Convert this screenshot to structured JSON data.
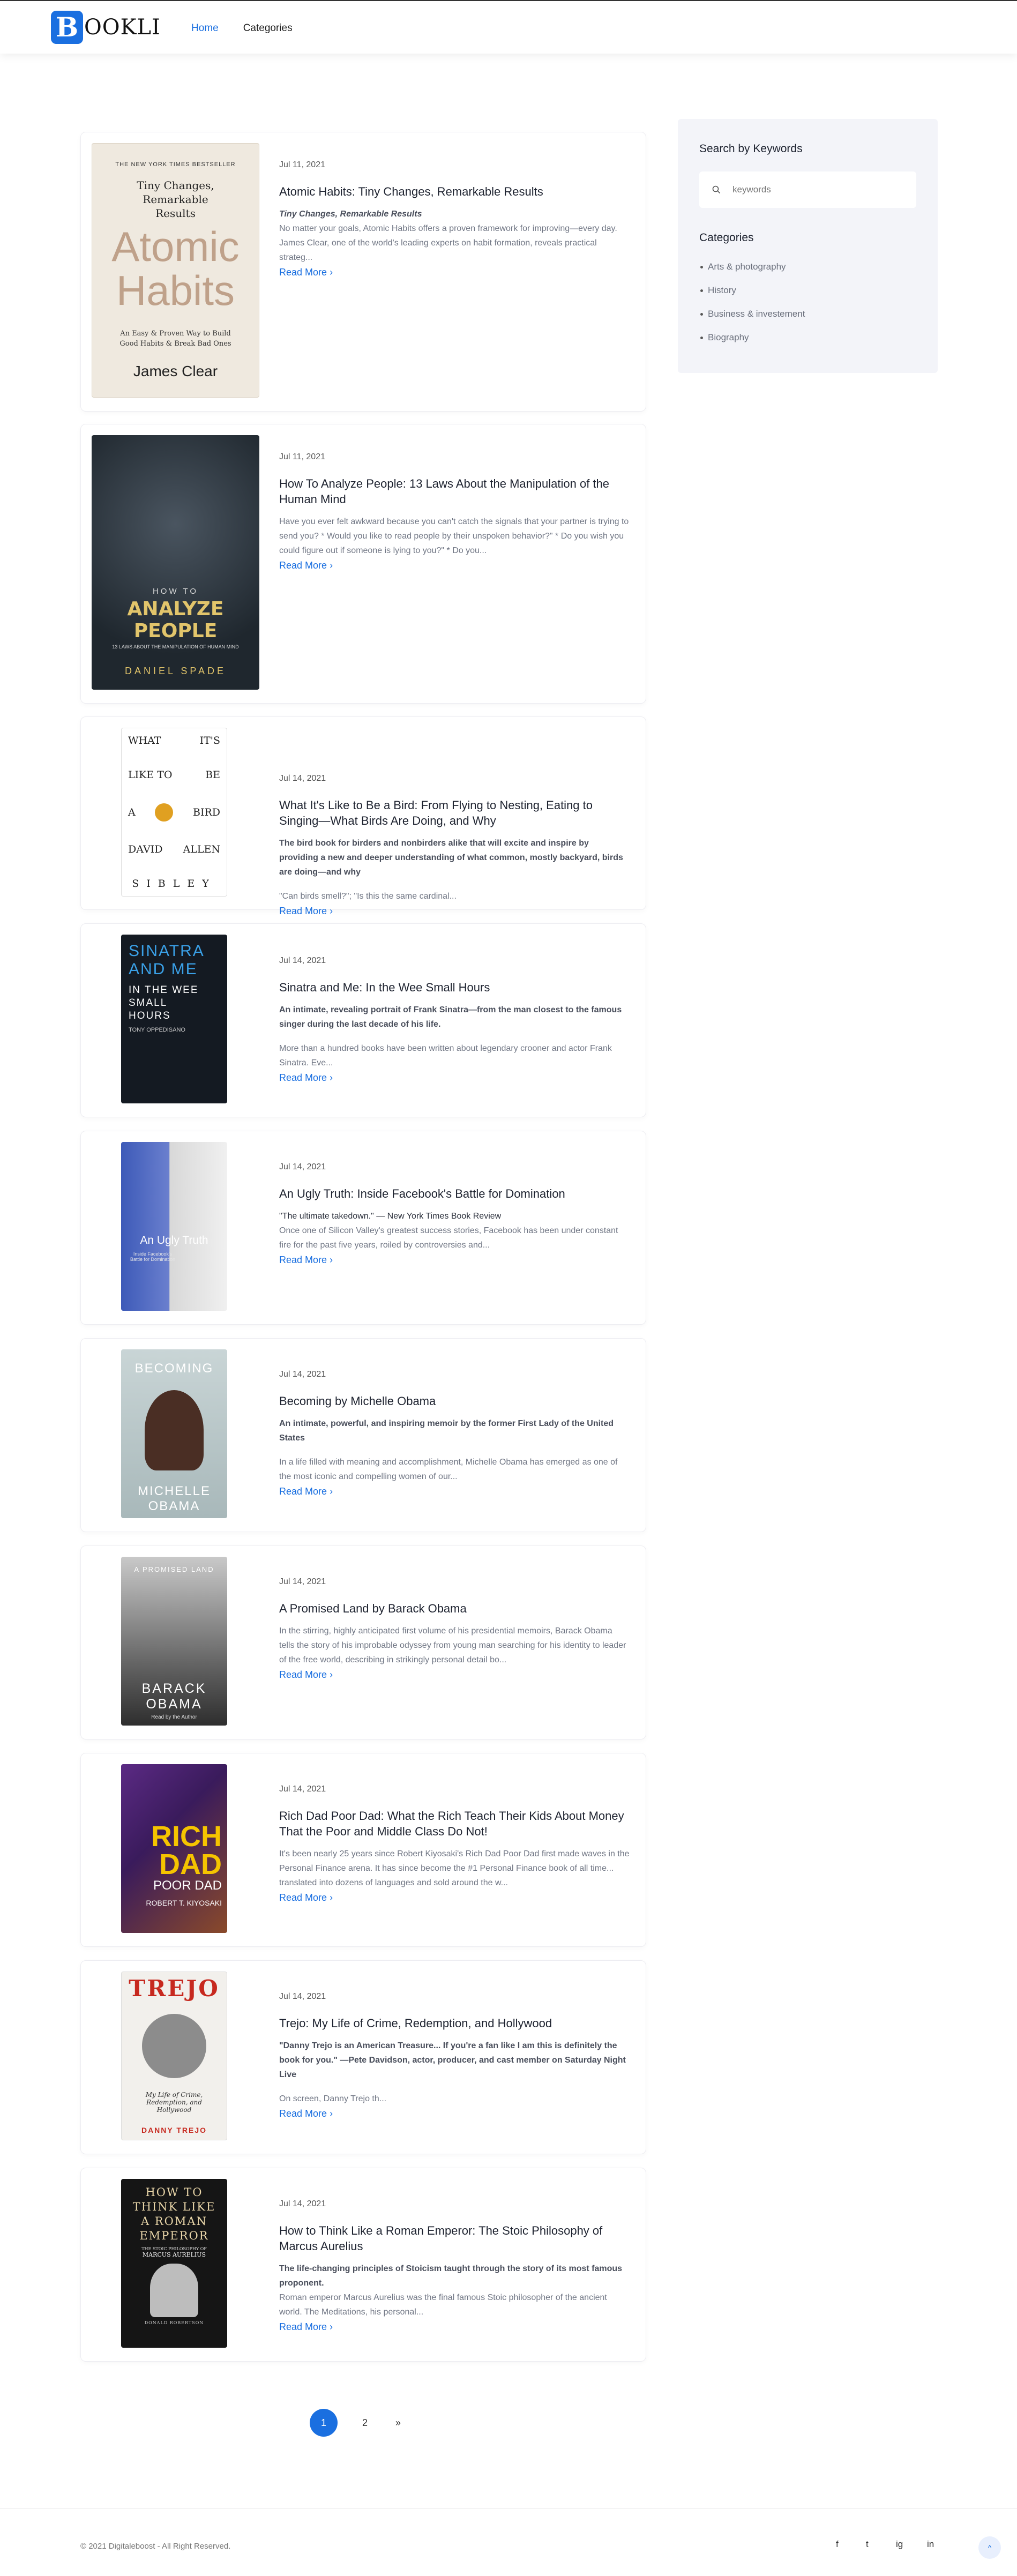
{
  "brand": {
    "logo_letter": "B",
    "logo_rest": "OOKLI",
    "accent": "#1a6fe0"
  },
  "nav": {
    "home": "Home",
    "categories": "Categories"
  },
  "read_more": "Read More",
  "posts": [
    {
      "date": "Jul 11, 2021",
      "title": "Atomic Habits: Tiny Changes, Remarkable Results",
      "subtitle": "Tiny Changes, Remarkable Results",
      "description": "No matter your goals, Atomic Habits offers a proven framework for improving—every day. James Clear, one of the world's leading experts on habit formation, reveals practical strateg...",
      "cover": {
        "top": "THE NEW YORK TIMES BESTSELLER",
        "head": "Tiny Changes, Remarkable Results",
        "big1": "Atomic",
        "big2": "Habits",
        "small": "An Easy & Proven Way to Build Good Habits & Break Bad Ones",
        "author": "James Clear"
      }
    },
    {
      "date": "Jul 11, 2021",
      "title": "How To Analyze People: 13 Laws About the Manipulation of the Human Mind",
      "description": "Have you ever felt awkward because you can't catch the signals that your partner is trying to send you? * Would you like to read people by their unspoken behavior?\" * Do you wish you could figure out if someone is lying to you?\" * Do you...",
      "cover": {
        "small": "HOW TO",
        "big": "ANALYZE PEOPLE",
        "tag": "13 LAWS ABOUT THE MANIPULATION OF HUMAN MIND",
        "author": "DANIEL SPADE"
      }
    },
    {
      "date": "Jul 14, 2021",
      "title": "What It's Like to Be a Bird: From Flying to Nesting, Eating to Singing—What Birds Are Doing, and Why",
      "subtitle": "The bird book for birders and nonbirders alike that will excite and inspire by providing a new and deeper understanding of what common, mostly backyard, birds are doing—and why",
      "description": "\"Can birds smell?\"; \"Is this the same cardinal...",
      "cover": {
        "l1a": "WHAT",
        "l1b": "IT'S",
        "l2a": "LIKE TO",
        "l2b": "BE",
        "l3a": "A",
        "l3b": "BIRD",
        "l4a": "DAVID",
        "l4b": "ALLEN",
        "l5": "SIBLEY"
      }
    },
    {
      "date": "Jul 14, 2021",
      "title": "Sinatra and Me: In the Wee Small Hours",
      "subtitle": "An intimate, revealing portrait of Frank Sinatra—from the man closest to the famous singer during the last decade of his life.",
      "description": "More than a hundred books have been written about legendary crooner and actor Frank Sinatra. Eve...",
      "cover": {
        "big1": "SINATRA",
        "big2": "AND ME",
        "l3": "IN THE WEE",
        "l4": "SMALL",
        "l5": "HOURS",
        "author": "TONY OPPEDISANO"
      }
    },
    {
      "date": "Jul 14, 2021",
      "title": "An Ugly Truth: Inside Facebook's Battle for Domination",
      "subtitle": "\"The ultimate takedown.\" — New York Times Book Review",
      "description": "Once one of Silicon Valley's greatest success stories, Facebook has been under constant fire for the past five years, roiled by controversies and...",
      "cover": {
        "big": "An Ugly Truth",
        "small": "Inside Facebook's Battle for Domination"
      }
    },
    {
      "date": "Jul 14, 2021",
      "title": "Becoming by Michelle Obama",
      "subtitle": "An intimate, powerful, and inspiring memoir by the former First Lady of the United States",
      "description": "In a life filled with meaning and accomplishment, Michelle Obama has emerged as one of the most iconic and compelling women of our...",
      "cover": {
        "top": "BECOMING",
        "n1": "MICHELLE",
        "n2": "OBAMA"
      }
    },
    {
      "date": "Jul 14, 2021",
      "title": "A Promised Land by Barack Obama",
      "description": "In the stirring, highly anticipated first volume of his presidential memoirs, Barack Obama tells the story of his improbable odyssey from young man searching for his identity to leader of the free world, describing in strikingly personal detail bo...",
      "cover": {
        "top": "A PROMISED LAND",
        "n1": "BARACK",
        "n2": "OBAMA",
        "note": "Read by the Author"
      }
    },
    {
      "date": "Jul 14, 2021",
      "title": "Rich Dad Poor Dad: What the Rich Teach Their Kids About Money That the Poor and Middle Class Do Not!",
      "description": "It's been nearly 25 years since Robert Kiyosaki's Rich Dad Poor Dad first made waves in the Personal Finance arena. It has since become the #1 Personal Finance book of all time... translated into dozens of languages and sold around the w...",
      "cover": {
        "r1": "RICH",
        "r2": "DAD",
        "r3": "POOR DAD",
        "author": "ROBERT T. KIYOSAKI"
      }
    },
    {
      "date": "Jul 14, 2021",
      "title": "Trejo: My Life of Crime, Redemption, and Hollywood",
      "subtitle": "\"Danny Trejo is an American Treasure... If you're a fan like I am this is definitely the book for you.\" —Pete Davidson, actor, producer, and cast member on Saturday Night Live",
      "description": "On screen, Danny Trejo th...",
      "cover": {
        "top": "TREJO",
        "script": "My Life of Crime, Redemption, and Hollywood",
        "author": "DANNY TREJO"
      }
    },
    {
      "date": "Jul 14, 2021",
      "title": "How to Think Like a Roman Emperor: The Stoic Philosophy of Marcus Aurelius",
      "subtitle": "The life-changing principles of Stoicism taught through the story of its most famous proponent.",
      "description": "Roman emperor Marcus Aurelius was the final famous Stoic philosopher of the ancient world. The Meditations, his personal...",
      "cover": {
        "l1": "HOW TO",
        "l2": "THINK LIKE",
        "l3": "A ROMAN",
        "l4": "EMPEROR",
        "l5": "THE STOIC PHILOSOPHY OF",
        "l6": "MARCUS AURELIUS",
        "author": "DONALD ROBERTSON"
      }
    }
  ],
  "sidebar": {
    "search_heading": "Search by Keywords",
    "search_placeholder": "keywords",
    "categories_heading": "Categories",
    "categories": [
      "Arts & photography",
      "History",
      "Business & investement",
      "Biography"
    ]
  },
  "pagination": {
    "page1": "1",
    "page2": "2",
    "next": "»"
  },
  "footer": {
    "copyright": "© 2021 Digitaleboost - All Right Reserved.",
    "social": [
      "f",
      "t",
      "ig",
      "in"
    ],
    "up": "^"
  }
}
